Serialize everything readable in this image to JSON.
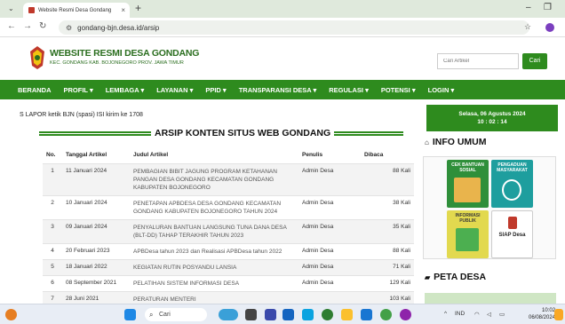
{
  "browser": {
    "tab_title": "Website Resmi Desa Gondang | ×",
    "tab_title_short": "Website Resmi Desa Gondang",
    "url": "gondang-bjn.desa.id/arsip"
  },
  "site": {
    "title": "WEBSITE RESMI DESA GONDANG",
    "subtitle": "KEC. GONDANG KAB. BOJONEGORO PROV. JAWA TIMUR",
    "search_placeholder": "Cari Artikel",
    "search_button": "Cari"
  },
  "menu": [
    "BERANDA",
    "PROFIL ▾",
    "LEMBAGA ▾",
    "LAYANAN ▾",
    "PPID ▾",
    "TRANSPARANSI DESA ▾",
    "REGULASI ▾",
    "POTENSI ▾",
    "LOGIN ▾"
  ],
  "marquee": "S LAPOR ketik BJN (spasi) ISI kirim ke 1708",
  "arsip": {
    "title": "ARSIP KONTEN SITUS WEB GONDANG",
    "headers": [
      "No.",
      "Tanggal Artikel",
      "Judul Artikel",
      "Penulis",
      "Dibaca"
    ],
    "rows": [
      [
        "1",
        "11 Januari 2024",
        "PEMBAGIAN BIBIT JAGUNG PROGRAM KETAHANAN PANGAN DESA GONDANG KECAMATAN GONDANG KABUPATEN BOJONEGORO",
        "Admin Desa",
        "88 Kali"
      ],
      [
        "2",
        "10 Januari 2024",
        "PENETAPAN APBDESA DESA GONDANG KECAMATAN GONDANG KABUPATEN BOJONEGORO TAHUN 2024",
        "Admin Desa",
        "38 Kali"
      ],
      [
        "3",
        "09 Januari 2024",
        "PENYALURAN BANTUAN LANGSUNG TUNA DANA DESA (BLT-DD) TAHAP TERAKHIR TAHUN 2023",
        "Admin Desa",
        "35 Kali"
      ],
      [
        "4",
        "20 Februari 2023",
        "APBDesa tahun 2023 dan Realisasi APBDesa tahun 2022",
        "Admin Desa",
        "88 Kali"
      ],
      [
        "5",
        "18 Januari 2022",
        "KEGIATAN RUTIN POSYANDU LANSIA",
        "Admin Desa",
        "71 Kali"
      ],
      [
        "6",
        "08 September 2021",
        "PELATIHAN SISTEM INFORMASI DESA",
        "Admin Desa",
        "129 Kali"
      ],
      [
        "7",
        "28 Juni 2021",
        "PERATURAN MENTERI",
        "",
        "103 Kali"
      ]
    ]
  },
  "sidebar": {
    "date": "Selasa, 06 Agustus 2024",
    "time": "10 : 02 : 14",
    "info_heading": "INFO UMUM",
    "thumbs": [
      "CEK BANTUAN SOSIAL",
      "PENGADUAN MASYARAKAT",
      "INFORMASI PUBLIK",
      "SIAP Desa"
    ],
    "peta_heading": "PETA DESA"
  },
  "taskbar": {
    "search": "Cari",
    "tray_lang": "IND",
    "clock_time": "10:02",
    "clock_date": "06/08/2024"
  }
}
